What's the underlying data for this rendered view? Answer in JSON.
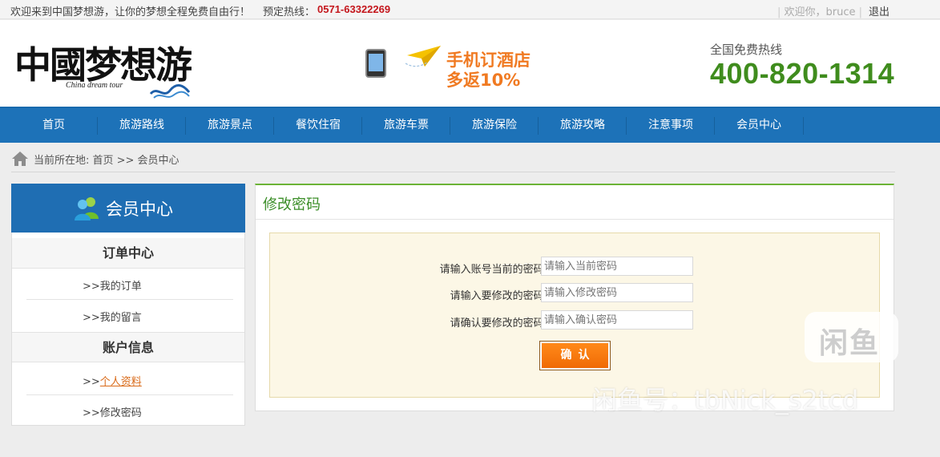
{
  "topbar": {
    "welcome": "欢迎来到中国梦想游，让你的梦想全程免费自由行！",
    "hotline_label": "预定热线：",
    "hotline_number": "0571-63322269",
    "user_greeting": "欢迎你，bruce",
    "logout": "退出"
  },
  "header": {
    "logo_cn": "中國梦想游",
    "logo_en": "China dream tour",
    "promo_line1": "手机订酒店",
    "promo_line2": "多返10%",
    "free_hotline_label": "全国免费热线",
    "free_hotline_number": "400-820-1314"
  },
  "nav": {
    "items": [
      {
        "label": "首页"
      },
      {
        "label": "旅游路线"
      },
      {
        "label": "旅游景点"
      },
      {
        "label": "餐饮住宿"
      },
      {
        "label": "旅游车票"
      },
      {
        "label": "旅游保险"
      },
      {
        "label": "旅游攻略"
      },
      {
        "label": "注意事项"
      },
      {
        "label": "会员中心"
      }
    ]
  },
  "breadcrumb": {
    "text": "当前所在地:  首页 >> 会员中心"
  },
  "sidebar": {
    "title": "会员中心",
    "groups": [
      {
        "title": "订单中心",
        "links": [
          {
            "prefix": ">>",
            "label": "我的订单"
          },
          {
            "prefix": ">>",
            "label": "我的留言"
          }
        ]
      },
      {
        "title": "账户信息",
        "links": [
          {
            "prefix": ">>",
            "label": "个人资料"
          },
          {
            "prefix": ">>",
            "label": "修改密码"
          }
        ]
      }
    ]
  },
  "panel": {
    "title": "修改密码",
    "fields": [
      {
        "label": "请输入账号当前的密码:",
        "placeholder": "请输入当前密码"
      },
      {
        "label": "请输入要修改的密码:",
        "placeholder": "请输入修改密码"
      },
      {
        "label": "请确认要修改的密码:",
        "placeholder": "请输入确认密码"
      }
    ],
    "confirm_label": "确认"
  },
  "watermark": {
    "logo_char": "闲鱼",
    "text": "闲鱼号：tbNick_s2tcd"
  },
  "colors": {
    "nav_blue": "#1d72b8",
    "accent_green": "#3f8c1d",
    "hotline_red": "#c4161c",
    "button_orange": "#f07a22"
  }
}
